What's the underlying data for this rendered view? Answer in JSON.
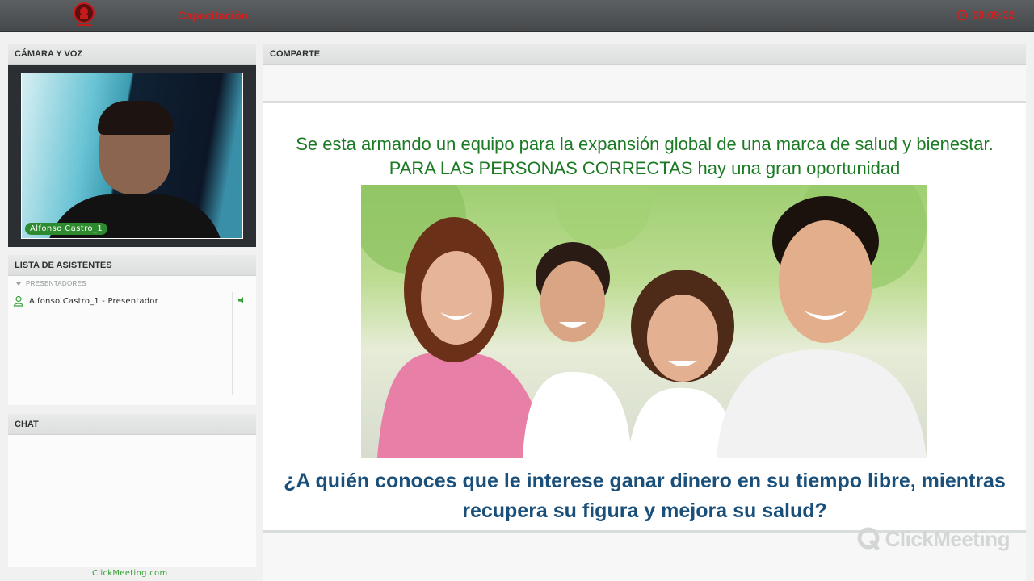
{
  "topbar": {
    "room_title": "Capacitación",
    "timer": "00:09:32"
  },
  "camera_panel": {
    "title": "CÁMARA Y VOZ",
    "participant_name": "Alfonso Castro_1"
  },
  "attendees_panel": {
    "title": "LISTA DE ASISTENTES",
    "section_label": "PRESENTADORES",
    "attendees": [
      {
        "label": "Alfonso Castro_1 - Presentador"
      }
    ]
  },
  "chat_panel": {
    "title": "CHAT"
  },
  "share_panel": {
    "title": "COMPARTE",
    "slide": {
      "top_text": "Se esta armando un equipo para la expansión global de una marca de salud y bienestar. PARA LAS PERSONAS CORRECTAS hay una gran oportunidad",
      "bottom_text": "¿A quién conoces que le interese ganar dinero en su tiempo libre, mientras recupera su figura y mejora su salud?"
    }
  },
  "footer": {
    "link": "ClickMeeting.com"
  },
  "watermark": {
    "text": "ClickMeeting"
  },
  "colors": {
    "accent_red": "#d41f1f",
    "accent_green": "#3aa13a",
    "slide_green_text": "#1b7a23",
    "slide_blue_text": "#1a4f7a"
  },
  "icons": [
    "company-logo-icon",
    "clock-icon",
    "user-icon",
    "speaker-icon",
    "collapse-arrow-icon",
    "clickmeeting-logo-icon"
  ]
}
